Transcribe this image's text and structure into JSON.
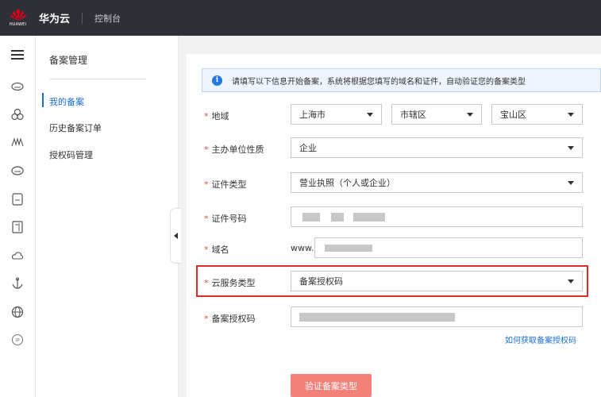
{
  "header": {
    "logo_text": "HUAWEI",
    "brand": "华为云",
    "console": "控制台"
  },
  "rail_icons": [
    "menu-icon",
    "cloud-icon",
    "cluster-icon",
    "monitor-icon",
    "storage-icon",
    "terminal-icon",
    "document-icon",
    "cloud-outline-icon",
    "anchor-icon",
    "globe-icon",
    "ip-icon"
  ],
  "submenu": {
    "title": "备案管理",
    "items": [
      {
        "label": "我的备案",
        "active": true
      },
      {
        "label": "历史备案订单",
        "active": false
      },
      {
        "label": "授权码管理",
        "active": false
      }
    ]
  },
  "info": {
    "icon": "i",
    "text": "请填写以下信息开始备案，系统将根据您填写的域名和证件，自动验证您的备案类型"
  },
  "form": {
    "required_mark": "*",
    "region": {
      "label": "地域",
      "province": "上海市",
      "city": "市辖区",
      "district": "宝山区"
    },
    "organizer": {
      "label": "主办单位性质",
      "value": "企业"
    },
    "cert_type": {
      "label": "证件类型",
      "value": "营业执照（个人或企业）"
    },
    "cert_number": {
      "label": "证件号码"
    },
    "domain": {
      "label": "域名",
      "prefix": "www."
    },
    "service_type": {
      "label": "云服务类型",
      "value": "备案授权码"
    },
    "auth_code": {
      "label": "备案授权码",
      "help_link": "如何获取备案授权码"
    }
  },
  "submit_label": "验证备案类型",
  "colors": {
    "topbar": "#2d3037",
    "accent_blue": "#1a6ed8",
    "required_red": "#e84d3d",
    "highlight_red": "#e02b2b",
    "button": "#f4807a",
    "huawei_logo": "#d7001b"
  }
}
